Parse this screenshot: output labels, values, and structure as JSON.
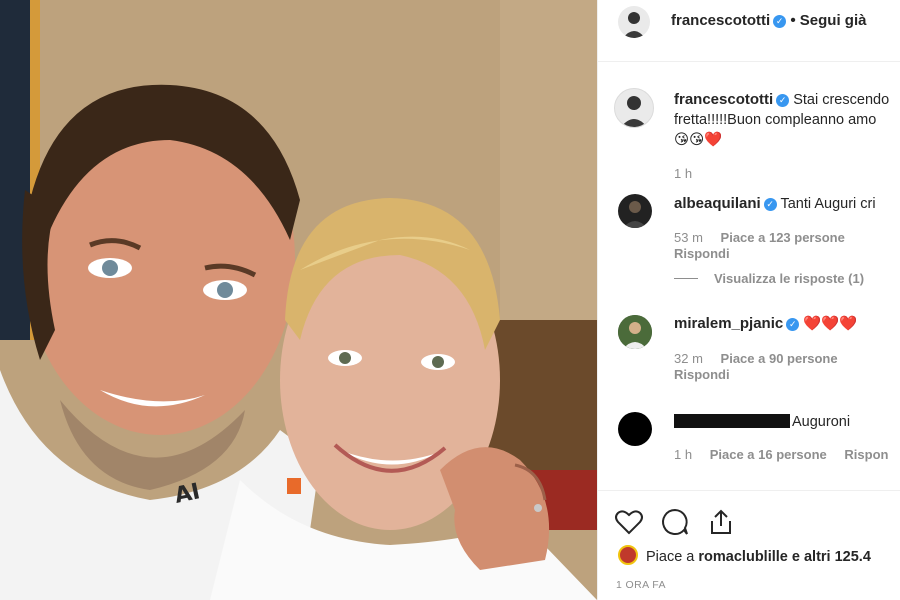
{
  "post": {
    "author": "francescototti",
    "follow_status": "Segui già"
  },
  "caption": {
    "author": "francescototti",
    "text_line1": "Stai crescendo",
    "text_line2": "fretta!!!!!Buon compleanno amo",
    "emojis": "😘😘❤️",
    "time": "1 h"
  },
  "comments": [
    {
      "author": "albeaquilani",
      "verified": true,
      "text": "Tanti Auguri cri",
      "time": "53 m",
      "likes": "Piace a 123 persone",
      "reply_label": "Rispondi",
      "view_replies": "Visualizza le risposte (1)"
    },
    {
      "author": "miralem_pjanic",
      "verified": true,
      "text": "❤️❤️❤️",
      "time": "32 m",
      "likes": "Piace a 90 persone",
      "reply_label": "Rispondi"
    },
    {
      "author": "",
      "verified": false,
      "text": "Auguroni",
      "time": "1 h",
      "likes": "Piace a 16 persone",
      "reply_label": "Rispon"
    }
  ],
  "actions": {
    "icons": [
      "heart-icon",
      "comment-icon",
      "share-icon"
    ],
    "liked_by_prefix": "Piace a",
    "liked_by_user": "romaclublille",
    "liked_by_suffix": "e altri 125.4",
    "posted_ago": "1 ORA FA"
  },
  "colors": {
    "verified_blue": "#3897f0",
    "heart_red": "#ed4956",
    "muted_text": "#8e8e8e",
    "border": "#efefef"
  }
}
